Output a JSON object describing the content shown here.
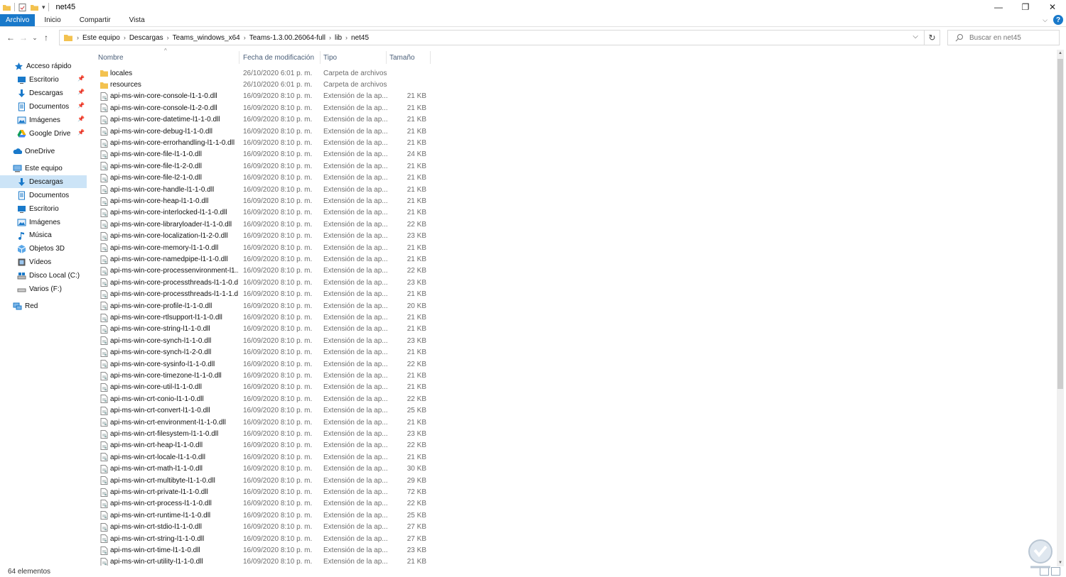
{
  "window": {
    "title": "net45",
    "minimize": "—",
    "restore": "❐",
    "close": "✕"
  },
  "ribbon": {
    "tabs": [
      "Archivo",
      "Inicio",
      "Compartir",
      "Vista"
    ],
    "expand": "⌵",
    "help": "?"
  },
  "address": {
    "crumbs": [
      "Este equipo",
      "Descargas",
      "Teams_windows_x64",
      "Teams-1.3.00.26064-full",
      "lib",
      "net45"
    ],
    "dropdown": "⌵",
    "refresh": "↻"
  },
  "search": {
    "placeholder": "Buscar en net45"
  },
  "nav": {
    "back": "←",
    "forward": "→",
    "recent": "⌄",
    "up": "↑"
  },
  "sidebar": {
    "items": [
      {
        "label": "Acceso rápido",
        "icon": "star-icon",
        "pinned": false
      },
      {
        "label": "Escritorio",
        "icon": "desktop-icon",
        "pinned": true
      },
      {
        "label": "Descargas",
        "icon": "download-icon",
        "pinned": true
      },
      {
        "label": "Documentos",
        "icon": "documents-icon",
        "pinned": true
      },
      {
        "label": "Imágenes",
        "icon": "pictures-icon",
        "pinned": true
      },
      {
        "label": "Google Drive",
        "icon": "google-drive-icon",
        "pinned": true
      },
      {
        "label": "OneDrive",
        "icon": "cloud-icon",
        "pinned": false
      },
      {
        "label": "Este equipo",
        "icon": "computer-icon",
        "pinned": false
      },
      {
        "label": "Descargas",
        "icon": "download-icon",
        "pinned": false,
        "selected": true
      },
      {
        "label": "Documentos",
        "icon": "documents-icon",
        "pinned": false
      },
      {
        "label": "Escritorio",
        "icon": "desktop-icon",
        "pinned": false
      },
      {
        "label": "Imágenes",
        "icon": "pictures-icon",
        "pinned": false
      },
      {
        "label": "Música",
        "icon": "music-icon",
        "pinned": false
      },
      {
        "label": "Objetos 3D",
        "icon": "cube-icon",
        "pinned": false
      },
      {
        "label": "Vídeos",
        "icon": "video-icon",
        "pinned": false
      },
      {
        "label": "Disco Local (C:)",
        "icon": "drive-icon",
        "pinned": false
      },
      {
        "label": "Varios (F:)",
        "icon": "drive-icon",
        "pinned": false
      },
      {
        "label": "Red",
        "icon": "network-icon",
        "pinned": false
      }
    ]
  },
  "columns": {
    "name": "Nombre",
    "date": "Fecha de modificación",
    "type": "Tipo",
    "size": "Tamaño"
  },
  "files": [
    {
      "name": "locales",
      "date": "26/10/2020 6:01 p. m.",
      "type": "Carpeta de archivos",
      "size": "",
      "kind": "folder"
    },
    {
      "name": "resources",
      "date": "26/10/2020 6:01 p. m.",
      "type": "Carpeta de archivos",
      "size": "",
      "kind": "folder"
    },
    {
      "name": "api-ms-win-core-console-l1-1-0.dll",
      "date": "16/09/2020 8:10 p. m.",
      "type": "Extensión de la ap...",
      "size": "21 KB",
      "kind": "dll"
    },
    {
      "name": "api-ms-win-core-console-l1-2-0.dll",
      "date": "16/09/2020 8:10 p. m.",
      "type": "Extensión de la ap...",
      "size": "21 KB",
      "kind": "dll"
    },
    {
      "name": "api-ms-win-core-datetime-l1-1-0.dll",
      "date": "16/09/2020 8:10 p. m.",
      "type": "Extensión de la ap...",
      "size": "21 KB",
      "kind": "dll"
    },
    {
      "name": "api-ms-win-core-debug-l1-1-0.dll",
      "date": "16/09/2020 8:10 p. m.",
      "type": "Extensión de la ap...",
      "size": "21 KB",
      "kind": "dll"
    },
    {
      "name": "api-ms-win-core-errorhandling-l1-1-0.dll",
      "date": "16/09/2020 8:10 p. m.",
      "type": "Extensión de la ap...",
      "size": "21 KB",
      "kind": "dll"
    },
    {
      "name": "api-ms-win-core-file-l1-1-0.dll",
      "date": "16/09/2020 8:10 p. m.",
      "type": "Extensión de la ap...",
      "size": "24 KB",
      "kind": "dll"
    },
    {
      "name": "api-ms-win-core-file-l1-2-0.dll",
      "date": "16/09/2020 8:10 p. m.",
      "type": "Extensión de la ap...",
      "size": "21 KB",
      "kind": "dll"
    },
    {
      "name": "api-ms-win-core-file-l2-1-0.dll",
      "date": "16/09/2020 8:10 p. m.",
      "type": "Extensión de la ap...",
      "size": "21 KB",
      "kind": "dll"
    },
    {
      "name": "api-ms-win-core-handle-l1-1-0.dll",
      "date": "16/09/2020 8:10 p. m.",
      "type": "Extensión de la ap...",
      "size": "21 KB",
      "kind": "dll"
    },
    {
      "name": "api-ms-win-core-heap-l1-1-0.dll",
      "date": "16/09/2020 8:10 p. m.",
      "type": "Extensión de la ap...",
      "size": "21 KB",
      "kind": "dll"
    },
    {
      "name": "api-ms-win-core-interlocked-l1-1-0.dll",
      "date": "16/09/2020 8:10 p. m.",
      "type": "Extensión de la ap...",
      "size": "21 KB",
      "kind": "dll"
    },
    {
      "name": "api-ms-win-core-libraryloader-l1-1-0.dll",
      "date": "16/09/2020 8:10 p. m.",
      "type": "Extensión de la ap...",
      "size": "22 KB",
      "kind": "dll"
    },
    {
      "name": "api-ms-win-core-localization-l1-2-0.dll",
      "date": "16/09/2020 8:10 p. m.",
      "type": "Extensión de la ap...",
      "size": "23 KB",
      "kind": "dll"
    },
    {
      "name": "api-ms-win-core-memory-l1-1-0.dll",
      "date": "16/09/2020 8:10 p. m.",
      "type": "Extensión de la ap...",
      "size": "21 KB",
      "kind": "dll"
    },
    {
      "name": "api-ms-win-core-namedpipe-l1-1-0.dll",
      "date": "16/09/2020 8:10 p. m.",
      "type": "Extensión de la ap...",
      "size": "21 KB",
      "kind": "dll"
    },
    {
      "name": "api-ms-win-core-processenvironment-l1...",
      "date": "16/09/2020 8:10 p. m.",
      "type": "Extensión de la ap...",
      "size": "22 KB",
      "kind": "dll"
    },
    {
      "name": "api-ms-win-core-processthreads-l1-1-0.dll",
      "date": "16/09/2020 8:10 p. m.",
      "type": "Extensión de la ap...",
      "size": "23 KB",
      "kind": "dll"
    },
    {
      "name": "api-ms-win-core-processthreads-l1-1-1.dll",
      "date": "16/09/2020 8:10 p. m.",
      "type": "Extensión de la ap...",
      "size": "21 KB",
      "kind": "dll"
    },
    {
      "name": "api-ms-win-core-profile-l1-1-0.dll",
      "date": "16/09/2020 8:10 p. m.",
      "type": "Extensión de la ap...",
      "size": "20 KB",
      "kind": "dll"
    },
    {
      "name": "api-ms-win-core-rtlsupport-l1-1-0.dll",
      "date": "16/09/2020 8:10 p. m.",
      "type": "Extensión de la ap...",
      "size": "21 KB",
      "kind": "dll"
    },
    {
      "name": "api-ms-win-core-string-l1-1-0.dll",
      "date": "16/09/2020 8:10 p. m.",
      "type": "Extensión de la ap...",
      "size": "21 KB",
      "kind": "dll"
    },
    {
      "name": "api-ms-win-core-synch-l1-1-0.dll",
      "date": "16/09/2020 8:10 p. m.",
      "type": "Extensión de la ap...",
      "size": "23 KB",
      "kind": "dll"
    },
    {
      "name": "api-ms-win-core-synch-l1-2-0.dll",
      "date": "16/09/2020 8:10 p. m.",
      "type": "Extensión de la ap...",
      "size": "21 KB",
      "kind": "dll"
    },
    {
      "name": "api-ms-win-core-sysinfo-l1-1-0.dll",
      "date": "16/09/2020 8:10 p. m.",
      "type": "Extensión de la ap...",
      "size": "22 KB",
      "kind": "dll"
    },
    {
      "name": "api-ms-win-core-timezone-l1-1-0.dll",
      "date": "16/09/2020 8:10 p. m.",
      "type": "Extensión de la ap...",
      "size": "21 KB",
      "kind": "dll"
    },
    {
      "name": "api-ms-win-core-util-l1-1-0.dll",
      "date": "16/09/2020 8:10 p. m.",
      "type": "Extensión de la ap...",
      "size": "21 KB",
      "kind": "dll"
    },
    {
      "name": "api-ms-win-crt-conio-l1-1-0.dll",
      "date": "16/09/2020 8:10 p. m.",
      "type": "Extensión de la ap...",
      "size": "22 KB",
      "kind": "dll"
    },
    {
      "name": "api-ms-win-crt-convert-l1-1-0.dll",
      "date": "16/09/2020 8:10 p. m.",
      "type": "Extensión de la ap...",
      "size": "25 KB",
      "kind": "dll"
    },
    {
      "name": "api-ms-win-crt-environment-l1-1-0.dll",
      "date": "16/09/2020 8:10 p. m.",
      "type": "Extensión de la ap...",
      "size": "21 KB",
      "kind": "dll"
    },
    {
      "name": "api-ms-win-crt-filesystem-l1-1-0.dll",
      "date": "16/09/2020 8:10 p. m.",
      "type": "Extensión de la ap...",
      "size": "23 KB",
      "kind": "dll"
    },
    {
      "name": "api-ms-win-crt-heap-l1-1-0.dll",
      "date": "16/09/2020 8:10 p. m.",
      "type": "Extensión de la ap...",
      "size": "22 KB",
      "kind": "dll"
    },
    {
      "name": "api-ms-win-crt-locale-l1-1-0.dll",
      "date": "16/09/2020 8:10 p. m.",
      "type": "Extensión de la ap...",
      "size": "21 KB",
      "kind": "dll"
    },
    {
      "name": "api-ms-win-crt-math-l1-1-0.dll",
      "date": "16/09/2020 8:10 p. m.",
      "type": "Extensión de la ap...",
      "size": "30 KB",
      "kind": "dll"
    },
    {
      "name": "api-ms-win-crt-multibyte-l1-1-0.dll",
      "date": "16/09/2020 8:10 p. m.",
      "type": "Extensión de la ap...",
      "size": "29 KB",
      "kind": "dll"
    },
    {
      "name": "api-ms-win-crt-private-l1-1-0.dll",
      "date": "16/09/2020 8:10 p. m.",
      "type": "Extensión de la ap...",
      "size": "72 KB",
      "kind": "dll"
    },
    {
      "name": "api-ms-win-crt-process-l1-1-0.dll",
      "date": "16/09/2020 8:10 p. m.",
      "type": "Extensión de la ap...",
      "size": "22 KB",
      "kind": "dll"
    },
    {
      "name": "api-ms-win-crt-runtime-l1-1-0.dll",
      "date": "16/09/2020 8:10 p. m.",
      "type": "Extensión de la ap...",
      "size": "25 KB",
      "kind": "dll"
    },
    {
      "name": "api-ms-win-crt-stdio-l1-1-0.dll",
      "date": "16/09/2020 8:10 p. m.",
      "type": "Extensión de la ap...",
      "size": "27 KB",
      "kind": "dll"
    },
    {
      "name": "api-ms-win-crt-string-l1-1-0.dll",
      "date": "16/09/2020 8:10 p. m.",
      "type": "Extensión de la ap...",
      "size": "27 KB",
      "kind": "dll"
    },
    {
      "name": "api-ms-win-crt-time-l1-1-0.dll",
      "date": "16/09/2020 8:10 p. m.",
      "type": "Extensión de la ap...",
      "size": "23 KB",
      "kind": "dll"
    },
    {
      "name": "api-ms-win-crt-utility-l1-1-0.dll",
      "date": "16/09/2020 8:10 p. m.",
      "type": "Extensión de la ap...",
      "size": "21 KB",
      "kind": "dll"
    }
  ],
  "status": {
    "count": "64 elementos"
  },
  "colors": {
    "accent": "#1979ca",
    "folder": "#f3c24f",
    "selection": "#cce4f7",
    "header_text": "#4c607a",
    "meta_text": "#6d6d6d"
  }
}
